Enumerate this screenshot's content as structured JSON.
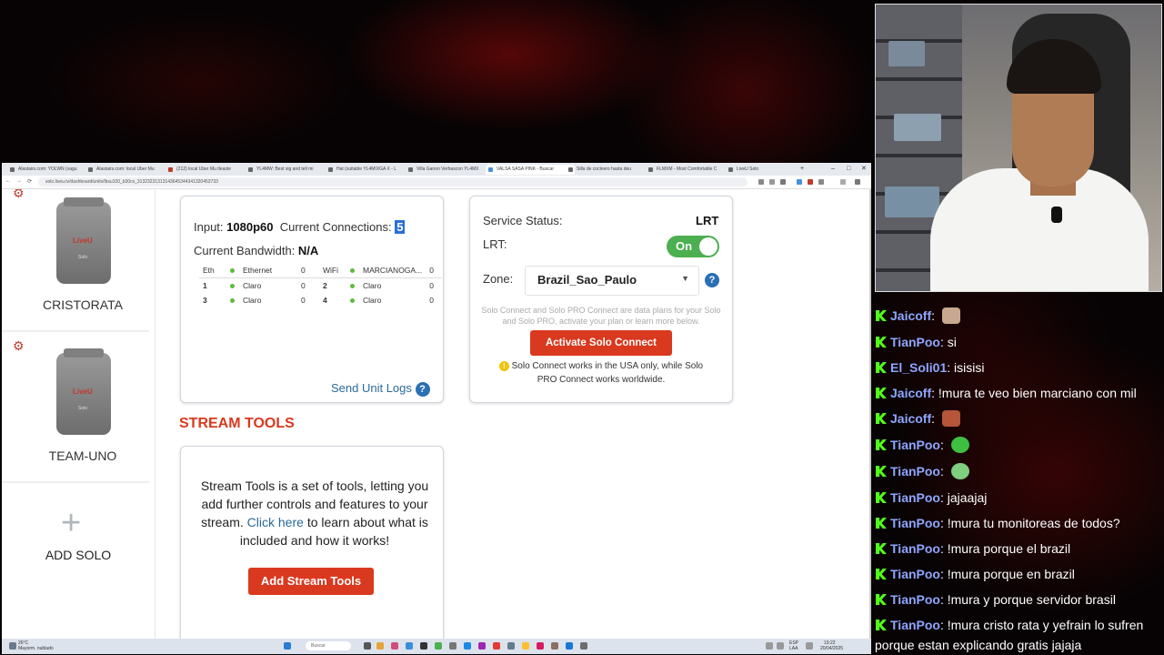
{
  "browser": {
    "tabs": [
      {
        "label": "Alastairs.com: YOLWN (vagu",
        "color": "#555"
      },
      {
        "label": "Alastairs.com: local Uber Mu",
        "color": "#555"
      },
      {
        "label": "(212) local Uber Mu tleaste",
        "color": "#c0392b"
      },
      {
        "label": "YL4MW: Best sig and tell mi",
        "color": "#777"
      },
      {
        "label": "Hat (suitable YL4MIXGA X - L",
        "color": "#777"
      },
      {
        "label": "Villa Ganon Verhascon YL4MX",
        "color": "#777"
      },
      {
        "label": "VALSA SASA PINK - Buscar",
        "color": "#4a90d9"
      },
      {
        "label": "Silla de cocinero hasta deu",
        "color": "#777"
      },
      {
        "label": "FLMXM - Most Comfortable C",
        "color": "#777"
      },
      {
        "label": "LiveU Solo",
        "color": "#777"
      }
    ],
    "new_tab": "+",
    "url": "solo.liveu.tv/dashboard/units/lbsu100_b30cs_31323231313143645344341320453733",
    "nav": {
      "back": "←",
      "forward": "→",
      "reload": "⟳"
    },
    "window_controls": {
      "minimize": "–",
      "maximize": "□",
      "close": "✕"
    }
  },
  "sidebar": {
    "units": [
      {
        "name": "CRISTORATA",
        "logo": "Live",
        "logo_accent": "U",
        "model": "Solo"
      },
      {
        "name": "TEAM-UNO",
        "logo": "Live",
        "logo_accent": "U",
        "model": "Solo"
      }
    ],
    "add_label": "ADD SOLO",
    "add_icon": "+"
  },
  "connections_card": {
    "input_label": "Input:",
    "input_value": "1080p60",
    "connections_label": "Current Connections:",
    "connections_value": "5",
    "bandwidth_label": "Current Bandwidth:",
    "bandwidth_value": "N/A",
    "table_header": {
      "eth": "Eth",
      "ethernet": "Ethernet",
      "eth_val": "0",
      "wifi": "WiFi",
      "wifi_name": "MARCIANOGA...",
      "wifi_val": "0"
    },
    "rows": [
      {
        "n1": "1",
        "l1": "Claro",
        "v1": "0",
        "n2": "2",
        "l2": "Claro",
        "v2": "0"
      },
      {
        "n1": "3",
        "l1": "Claro",
        "v1": "0",
        "n2": "4",
        "l2": "Claro",
        "v2": "0"
      }
    ],
    "send_logs": "Send Unit Logs",
    "help_icon": "?"
  },
  "service_card": {
    "status_label": "Service Status:",
    "status_value": "LRT",
    "lrt_label": "LRT:",
    "lrt_toggle": "On",
    "zone_label": "Zone:",
    "zone_value": "Brazil_Sao_Paulo",
    "zone_caret": "▼",
    "help_icon": "?",
    "note": "Solo Connect and Solo PRO Connect are data plans for your Solo and Solo PRO, activate your plan or learn more below.",
    "activate_button": "Activate Solo Connect",
    "warning_icon": "!",
    "warning": "Solo Connect works in the USA only, while Solo PRO Connect works worldwide."
  },
  "stream_tools": {
    "title": "STREAM TOOLS",
    "text_before": "Stream Tools is a set of tools, letting you add further controls and features to your stream.",
    "link": "Click here",
    "text_after": "to learn about what is included and how it works!",
    "button": "Add Stream Tools"
  },
  "taskbar": {
    "weather": "26°C",
    "weather_desc": "Mayorm. nublado",
    "search_placeholder": "Buscar",
    "lang": "ESP",
    "lang2": "LAA",
    "time": "19:22",
    "date": "20/04/2025"
  },
  "chat": {
    "messages": [
      {
        "user": "Jaicoff",
        "text": "",
        "user_color": "#8fa6ff",
        "emote_color": "#c8a890"
      },
      {
        "user": "TianPoo",
        "text": "si",
        "user_color": "#8fa6ff"
      },
      {
        "user": "El_Soli01",
        "text": "isisisi",
        "user_color": "#8fa6ff"
      },
      {
        "user": "Jaicoff",
        "text": "!mura te veo bien marciano con mil",
        "user_color": "#8fa6ff"
      },
      {
        "user": "Jaicoff",
        "text": "",
        "user_color": "#8fa6ff",
        "emote_color": "#b5553a"
      },
      {
        "user": "TianPoo",
        "text": "",
        "user_color": "#8fa6ff",
        "emote_color": "#3fbf3f"
      },
      {
        "user": "TianPoo",
        "text": "",
        "user_color": "#8fa6ff",
        "emote_color": "#7fcf7f"
      },
      {
        "user": "TianPoo",
        "text": "jajaajaj",
        "user_color": "#8fa6ff"
      },
      {
        "user": "TianPoo",
        "text": "!mura tu monitoreas de todos?",
        "user_color": "#8fa6ff"
      },
      {
        "user": "TianPoo",
        "text": "!mura porque el brazil",
        "user_color": "#8fa6ff"
      },
      {
        "user": "TianPoo",
        "text": "!mura porque en brazil",
        "user_color": "#8fa6ff"
      },
      {
        "user": "TianPoo",
        "text": "!mura y porque servidor brasil",
        "user_color": "#8fa6ff"
      },
      {
        "user": "TianPoo",
        "text": "!mura cristo rata y yefrain lo sufren",
        "user_color": "#8fa6ff"
      }
    ],
    "wrap_line": "porque estan explicando gratis jajaja"
  }
}
